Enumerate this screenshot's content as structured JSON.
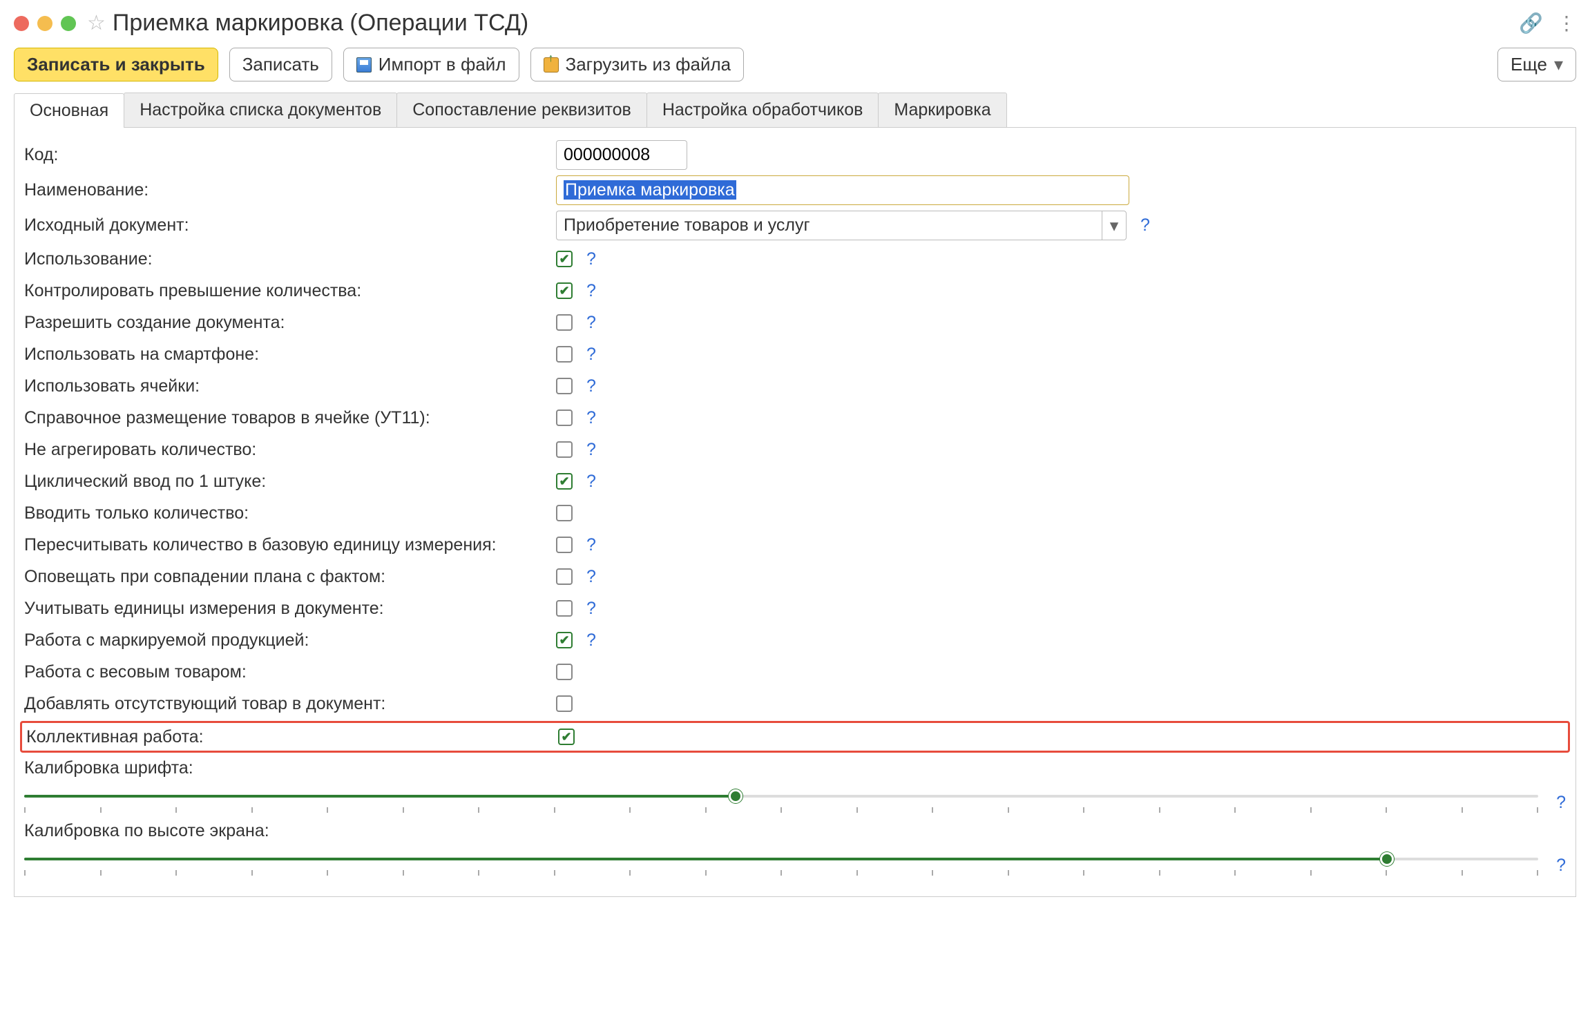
{
  "window": {
    "title": "Приемка маркировка (Операции ТСД)"
  },
  "toolbar": {
    "save_close": "Записать и закрыть",
    "save": "Записать",
    "import": "Импорт в файл",
    "load": "Загрузить из файла",
    "more": "Еще"
  },
  "tabs": [
    "Основная",
    "Настройка списка документов",
    "Сопоставление реквизитов",
    "Настройка обработчиков",
    "Маркировка"
  ],
  "form": {
    "code_label": "Код:",
    "code_value": "000000008",
    "name_label": "Наименование:",
    "name_value": "Приемка маркировка",
    "src_label": "Исходный документ:",
    "src_value": "Приобретение товаров и услуг"
  },
  "checks": [
    {
      "label": "Использование:",
      "checked": true,
      "help": true
    },
    {
      "label": "Контролировать превышение количества:",
      "checked": true,
      "help": true
    },
    {
      "label": "Разрешить создание документа:",
      "checked": false,
      "help": true
    },
    {
      "label": "Использовать на смартфоне:",
      "checked": false,
      "help": true
    },
    {
      "label": "Использовать ячейки:",
      "checked": false,
      "help": true
    },
    {
      "label": "Справочное размещение товаров в ячейке (УТ11):",
      "checked": false,
      "help": true
    },
    {
      "label": "Не агрегировать количество:",
      "checked": false,
      "help": true
    },
    {
      "label": "Циклический ввод по 1 штуке:",
      "checked": true,
      "help": true
    },
    {
      "label": "Вводить только количество:",
      "checked": false,
      "help": false
    },
    {
      "label": "Пересчитывать количество в базовую единицу измерения:",
      "checked": false,
      "help": true
    },
    {
      "label": "Оповещать при совпадении плана с фактом:",
      "checked": false,
      "help": true
    },
    {
      "label": "Учитывать единицы измерения в документе:",
      "checked": false,
      "help": true
    },
    {
      "label": "Работа с маркируемой продукцией:",
      "checked": true,
      "help": true
    },
    {
      "label": "Работа с весовым товаром:",
      "checked": false,
      "help": false
    },
    {
      "label": "Добавлять отсутствующий товар в документ:",
      "checked": false,
      "help": false
    },
    {
      "label": "Коллективная работа:",
      "checked": true,
      "help": false,
      "highlighted": true
    }
  ],
  "sliders": {
    "font": {
      "label": "Калибровка шрифта:",
      "value": 47,
      "ticks": 21,
      "help": "?"
    },
    "height": {
      "label": "Калибровка по высоте экрана:",
      "value": 90,
      "ticks": 21,
      "help": "?"
    }
  },
  "help_glyph": "?"
}
